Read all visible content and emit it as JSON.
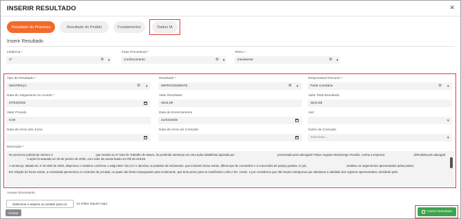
{
  "header": {
    "title": "INSERIR RESULTADO",
    "close_glyph": "✕"
  },
  "tabs": [
    {
      "label": "Resultado do Processo",
      "active": true
    },
    {
      "label": "Resultado do Pedido",
      "active": false
    },
    {
      "label": "Fundamentos",
      "active": false
    },
    {
      "label": "Dados IA",
      "active": false
    }
  ],
  "section_title": "Inserir Resultado",
  "top_fields": {
    "instancia": {
      "label": "Instância *",
      "value": "1ª"
    },
    "fase": {
      "label": "Fase Processual *",
      "value": "Conhecimento"
    },
    "risco": {
      "label": "Risco *",
      "value": "inexistente"
    }
  },
  "form": {
    "tipo_resultado": {
      "label": "Tipo de Resultado *",
      "value": "SENTENÇA"
    },
    "resultado": {
      "label": "Resultado *",
      "value": "IMPROCEDENTE"
    },
    "responsavel_recurso": {
      "label": "Responsável Recurso *",
      "value": "Parte Contrária"
    },
    "data_julgamento": {
      "label": "Data do Julgamento ou Acordo *",
      "value": "07/04/2025"
    },
    "valor_resultado": {
      "label": "Valor Resultado",
      "value": "4641,69"
    },
    "valor_total_resultado": {
      "label": "Valor Total Resultado",
      "value": "4641,69"
    },
    "valor_provido": {
      "label": "Valor Provido",
      "value": "0,00"
    },
    "data_encerramento": {
      "label": "Data de Encerramento",
      "value": "21/04/2025"
    },
    "juiz": {
      "label": "Juiz",
      "value": ""
    },
    "data_inicio_juros": {
      "label": "Data de Início dos Juros",
      "value": ""
    },
    "data_inicio_correcao": {
      "label": "Data de Início da Correção",
      "value": ""
    },
    "indice_correcao": {
      "label": "Índice de Correção",
      "placeholder": "Selecione..."
    }
  },
  "descricao": {
    "label": "Descrição *",
    "p1a": "No processo judicial de número 0",
    "p1b": "que tramita na 2ª Vara do Trabalho de Bauru, foi proferida sentença em uma ação trabalhista ajuizada por",
    "p1c": "presentada pelo advogado Felipe Augusto Montenegro Romão, contra a empresa",
    "p1d": "defendida pelo advogad",
    "p1e": "A ação foi autuada em 09 de janeiro de 2025, com valor da causa fixado em R$ 46.419,56.",
    "p2a": "A sentença, datada de 1º de abril de 2025, dispensou o relatório conforme o artigo 852-I da CLT e abordou os pedidos da reclamante, que incluíam horas extras, diferenças de comissões e a concessão de justiça gratuita. O juiz,",
    "p2b": "analisou os argumentos apresentados pelas partes.",
    "p3": "Em relação às horas extras, a reclamada apresentou os controles de jornada, os quais não foram impugnados pela reclamante, que teria prazo para se manifestar a não o fez. Assim, o juiz considerou que não havia contraprova que afastasse a validade dos registros apresentados, decidindo pela"
  },
  "anexar": {
    "label": "Anexar Documento",
    "button": "Selecione o arquivo ou arraste para cá",
    "drop_text": "ou Soltar arquivo aqui"
  },
  "footer": {
    "close_label": "Fechar",
    "insert_label": "Inserir Resultado"
  },
  "colors": {
    "accent": "#f26a2a",
    "success": "#3fa34d",
    "highlight": "#e03b3b"
  }
}
